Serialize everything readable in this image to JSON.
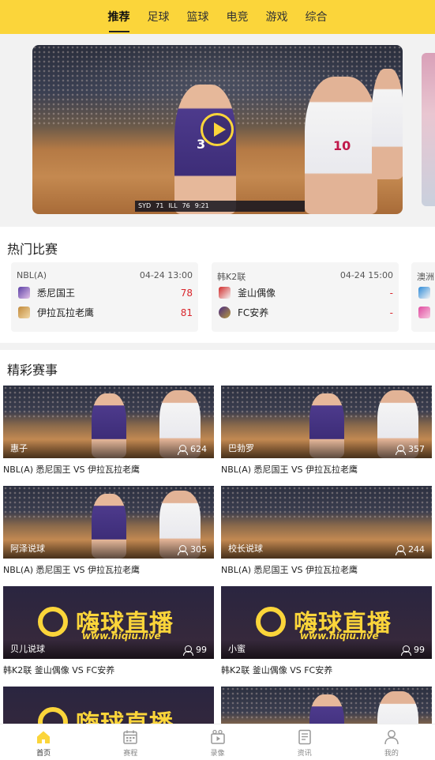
{
  "tabs": [
    {
      "label": "推荐",
      "active": true
    },
    {
      "label": "足球",
      "active": false
    },
    {
      "label": "篮球",
      "active": false
    },
    {
      "label": "电竞",
      "active": false
    },
    {
      "label": "游戏",
      "active": false
    },
    {
      "label": "综合",
      "active": false
    }
  ],
  "banner": {
    "scorebug": {
      "home": "SYD",
      "home_score": "71",
      "away": "ILL",
      "away_score": "76",
      "clock": "9:21"
    },
    "jersey_left": "3",
    "jersey_right": "10"
  },
  "hot": {
    "title": "热门比赛",
    "matches": [
      {
        "league": "NBL(A)",
        "time": "04-24 13:00",
        "teams": [
          {
            "name": "悉尼国王",
            "score": "78"
          },
          {
            "name": "伊拉瓦拉老鹰",
            "score": "81"
          }
        ]
      },
      {
        "league": "韩K2联",
        "time": "04-24 15:00",
        "teams": [
          {
            "name": "釜山偶像",
            "score": "-"
          },
          {
            "name": "FC安养",
            "score": "-"
          }
        ]
      },
      {
        "league": "澳洲",
        "time": "",
        "teams": [
          {
            "name": "",
            "score": ""
          },
          {
            "name": "",
            "score": ""
          }
        ]
      }
    ]
  },
  "featured": {
    "title": "精彩赛事",
    "cards": [
      {
        "streamer": "惠子",
        "viewers": "624",
        "title": "NBL(A) 悉尼国王 VS 伊拉瓦拉老鹰",
        "thumb": "basketball"
      },
      {
        "streamer": "巴勃罗",
        "viewers": "357",
        "title": "NBL(A) 悉尼国王 VS 伊拉瓦拉老鹰",
        "thumb": "basketball"
      },
      {
        "streamer": "阿泽说球",
        "viewers": "305",
        "title": "NBL(A) 悉尼国王 VS 伊拉瓦拉老鹰",
        "thumb": "basketball"
      },
      {
        "streamer": "校长说球",
        "viewers": "244",
        "title": "NBL(A) 悉尼国王 VS 伊拉瓦拉老鹰",
        "thumb": "basketball-wide"
      },
      {
        "streamer": "贝儿说球",
        "viewers": "99",
        "title": "韩K2联 釜山偶像 VS FC安养",
        "thumb": "logo"
      },
      {
        "streamer": "小蜜",
        "viewers": "99",
        "title": "韩K2联 釜山偶像 VS FC安养",
        "thumb": "logo"
      },
      {
        "streamer": "",
        "viewers": "",
        "title": "",
        "thumb": "logo"
      },
      {
        "streamer": "",
        "viewers": "",
        "title": "",
        "thumb": "basketball"
      }
    ],
    "logo_text": "嗨球直播",
    "logo_url": "www.hiqiu.live"
  },
  "nav": [
    {
      "label": "首页",
      "icon": "home-icon",
      "active": true
    },
    {
      "label": "赛程",
      "icon": "calendar-icon",
      "active": false
    },
    {
      "label": "录像",
      "icon": "video-icon",
      "active": false
    },
    {
      "label": "资讯",
      "icon": "news-icon",
      "active": false
    },
    {
      "label": "我的",
      "icon": "profile-icon",
      "active": false
    }
  ],
  "colors": {
    "accent": "#fbd53a",
    "score": "#d9262c"
  }
}
